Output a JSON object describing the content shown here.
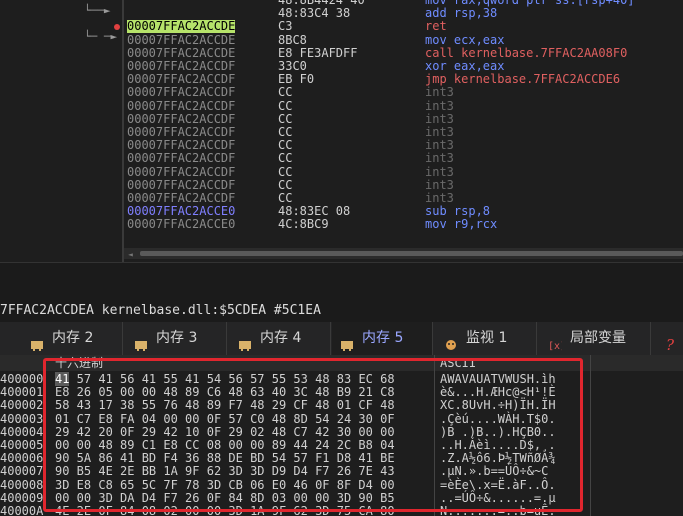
{
  "disasm": {
    "rows": [
      {
        "addr": "",
        "bytes": "48:8B4424 40",
        "instr": "mov rax,qword ptr ss:[rsp+40]",
        "style": "blue"
      },
      {
        "addr": "",
        "bytes": "48:83C4 38",
        "instr": "add rsp,38",
        "style": "blue"
      },
      {
        "addr": "00007FFAC2ACCDE",
        "bytes": "C3",
        "instr": "ret",
        "style": "red",
        "highlight": true
      },
      {
        "addr": "00007FFAC2ACCDE",
        "bytes": "8BC8",
        "instr": "mov ecx,eax",
        "style": "blue"
      },
      {
        "addr": "00007FFAC2ACCDE",
        "bytes": "E8 FE3AFDFF",
        "instr": "call kernelbase.7FFAC2AA08F0",
        "style": "red"
      },
      {
        "addr": "00007FFAC2ACCDF",
        "bytes": "33C0",
        "instr": "xor eax,eax",
        "style": "blue"
      },
      {
        "addr": "00007FFAC2ACCDF",
        "bytes": "EB F0",
        "instr": "jmp kernelbase.7FFAC2ACCDE6",
        "style": "red"
      },
      {
        "addr": "00007FFAC2ACCDF",
        "bytes": "CC",
        "instr": "int3",
        "style": "dim"
      },
      {
        "addr": "00007FFAC2ACCDF",
        "bytes": "CC",
        "instr": "int3",
        "style": "dim"
      },
      {
        "addr": "00007FFAC2ACCDF",
        "bytes": "CC",
        "instr": "int3",
        "style": "dim"
      },
      {
        "addr": "00007FFAC2ACCDF",
        "bytes": "CC",
        "instr": "int3",
        "style": "dim"
      },
      {
        "addr": "00007FFAC2ACCDF",
        "bytes": "CC",
        "instr": "int3",
        "style": "dim"
      },
      {
        "addr": "00007FFAC2ACCDF",
        "bytes": "CC",
        "instr": "int3",
        "style": "dim"
      },
      {
        "addr": "00007FFAC2ACCDF",
        "bytes": "CC",
        "instr": "int3",
        "style": "dim"
      },
      {
        "addr": "00007FFAC2ACCDF",
        "bytes": "CC",
        "instr": "int3",
        "style": "dim"
      },
      {
        "addr": "00007FFAC2ACCDF",
        "bytes": "CC",
        "instr": "int3",
        "style": "dim"
      },
      {
        "addr": "00007FFAC2ACCE0",
        "bytes": "48:83EC 08",
        "instr": "sub rsp,8",
        "style": "blue",
        "addrBlue": true
      },
      {
        "addr": "00007FFAC2ACCE0",
        "bytes": "4C:8BC9",
        "instr": "mov r9,rcx",
        "style": "blue"
      }
    ]
  },
  "info": {
    "text": "7FFAC2ACCDEA kernelbase.dll:$5CDEA #5C1EA"
  },
  "tabs": [
    {
      "label": "内存 2",
      "active": false
    },
    {
      "label": "内存 3",
      "active": false
    },
    {
      "label": "内存 4",
      "active": false
    },
    {
      "label": "内存 5",
      "active": true
    },
    {
      "label": "监视 1",
      "active": false
    },
    {
      "label": "局部变量",
      "active": false
    }
  ],
  "dump": {
    "hex_header": "十六进制",
    "ascii_header": "ASCII",
    "rows": [
      {
        "addr": "400000",
        "first": "41",
        "hex": " 57 41 56 41 55 41 54 56 57 55 53 48 83 EC 68",
        "ascii": "AWAVAUATVWUSH.ìh"
      },
      {
        "addr": "400001",
        "first": "",
        "hex": "E8 26 05 00 00 48 89 C6 48 63 40 3C 48 B9 21 C8",
        "ascii": "è&...H.ÆHc@<H¹!È"
      },
      {
        "addr": "400002",
        "first": "",
        "hex": "58 43 17 38 55 76 48 89 F7 48 29 CF 48 01 CF 48",
        "ascii": "XC.8UvH.÷H)ÏH.ÏH"
      },
      {
        "addr": "400003",
        "first": "",
        "hex": "01 C7 E8 FA 04 00 00 0F 57 C0 48 8D 54 24 30 0F",
        "ascii": ".Çèú....WÀH.T$0."
      },
      {
        "addr": "400004",
        "first": "",
        "hex": "29 42 20 0F 29 42 10 0F 29 02 48 C7 42 30 00 00",
        "ascii": ")B .)B..).HÇB0.."
      },
      {
        "addr": "400005",
        "first": "",
        "hex": "00 00 48 89 C1 E8 CC 08 00 00 89 44 24 2C B8 04",
        "ascii": "..H.Áèì....D$,¸."
      },
      {
        "addr": "400006",
        "first": "",
        "hex": "90 5A 86 41 BD F4 36 88 DE BD 54 57 F1 D8 41 BE",
        "ascii": ".Z.A½ô6.Þ½TWñØA¾"
      },
      {
        "addr": "400007",
        "first": "",
        "hex": "90 B5 4E 2E BB 1A 9F 62 3D 3D D9 D4 F7 26 7E 43",
        "ascii": ".µN.».b==ÙÔ÷&~C"
      },
      {
        "addr": "400008",
        "first": "",
        "hex": "3D E8 C8 65 5C 7F 78 3D CB 06 E0 46 0F 8F D4 00",
        "ascii": "=èÈe\\.x=Ë.àF..Ô."
      },
      {
        "addr": "400009",
        "first": "",
        "hex": "00 00 3D DA D4 F7 26 0F 84 8D 03 00 00 3D 90 B5",
        "ascii": "..=ÚÔ÷&......=.µ"
      },
      {
        "addr": "40000A",
        "first": "",
        "hex": "4E 2E 0F 84 08 02 00 00 3D 1A 9F 62 3D 75 CA 80",
        "ascii": "N.......=..b=uÊ."
      }
    ]
  },
  "colors": {
    "highlight": "#b6e36a",
    "red_box": "#e0262e",
    "active_tab": "#9aa7ff"
  }
}
